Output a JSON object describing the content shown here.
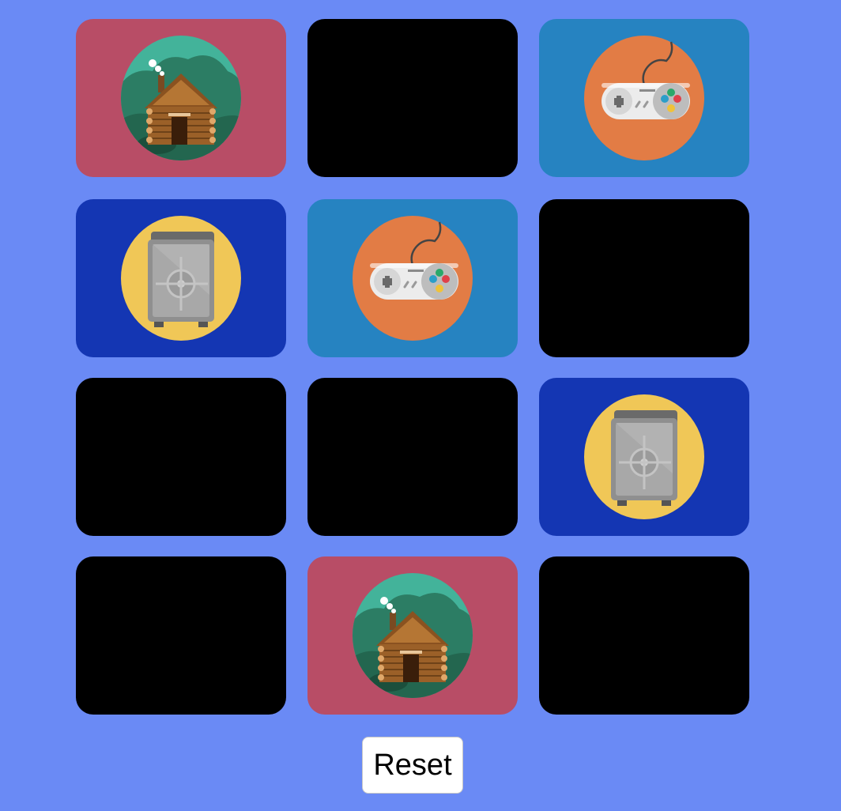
{
  "game": {
    "cards": [
      {
        "state": "revealed",
        "icon": "cabin-icon",
        "back_color": "#b84d66"
      },
      {
        "state": "hidden"
      },
      {
        "state": "revealed",
        "icon": "gamepad-icon",
        "back_color": "#2683c1"
      },
      {
        "state": "revealed",
        "icon": "safe-icon",
        "back_color": "#1436b3"
      },
      {
        "state": "revealed",
        "icon": "gamepad-icon",
        "back_color": "#2683c1"
      },
      {
        "state": "hidden"
      },
      {
        "state": "hidden"
      },
      {
        "state": "hidden"
      },
      {
        "state": "revealed",
        "icon": "safe-icon",
        "back_color": "#1436b3"
      },
      {
        "state": "hidden"
      },
      {
        "state": "revealed",
        "icon": "cabin-icon",
        "back_color": "#b84d66"
      },
      {
        "state": "hidden"
      }
    ],
    "columns": 3,
    "reset_label": "Reset"
  },
  "colors": {
    "background": "#6a8af5",
    "hidden_card": "#000000"
  }
}
